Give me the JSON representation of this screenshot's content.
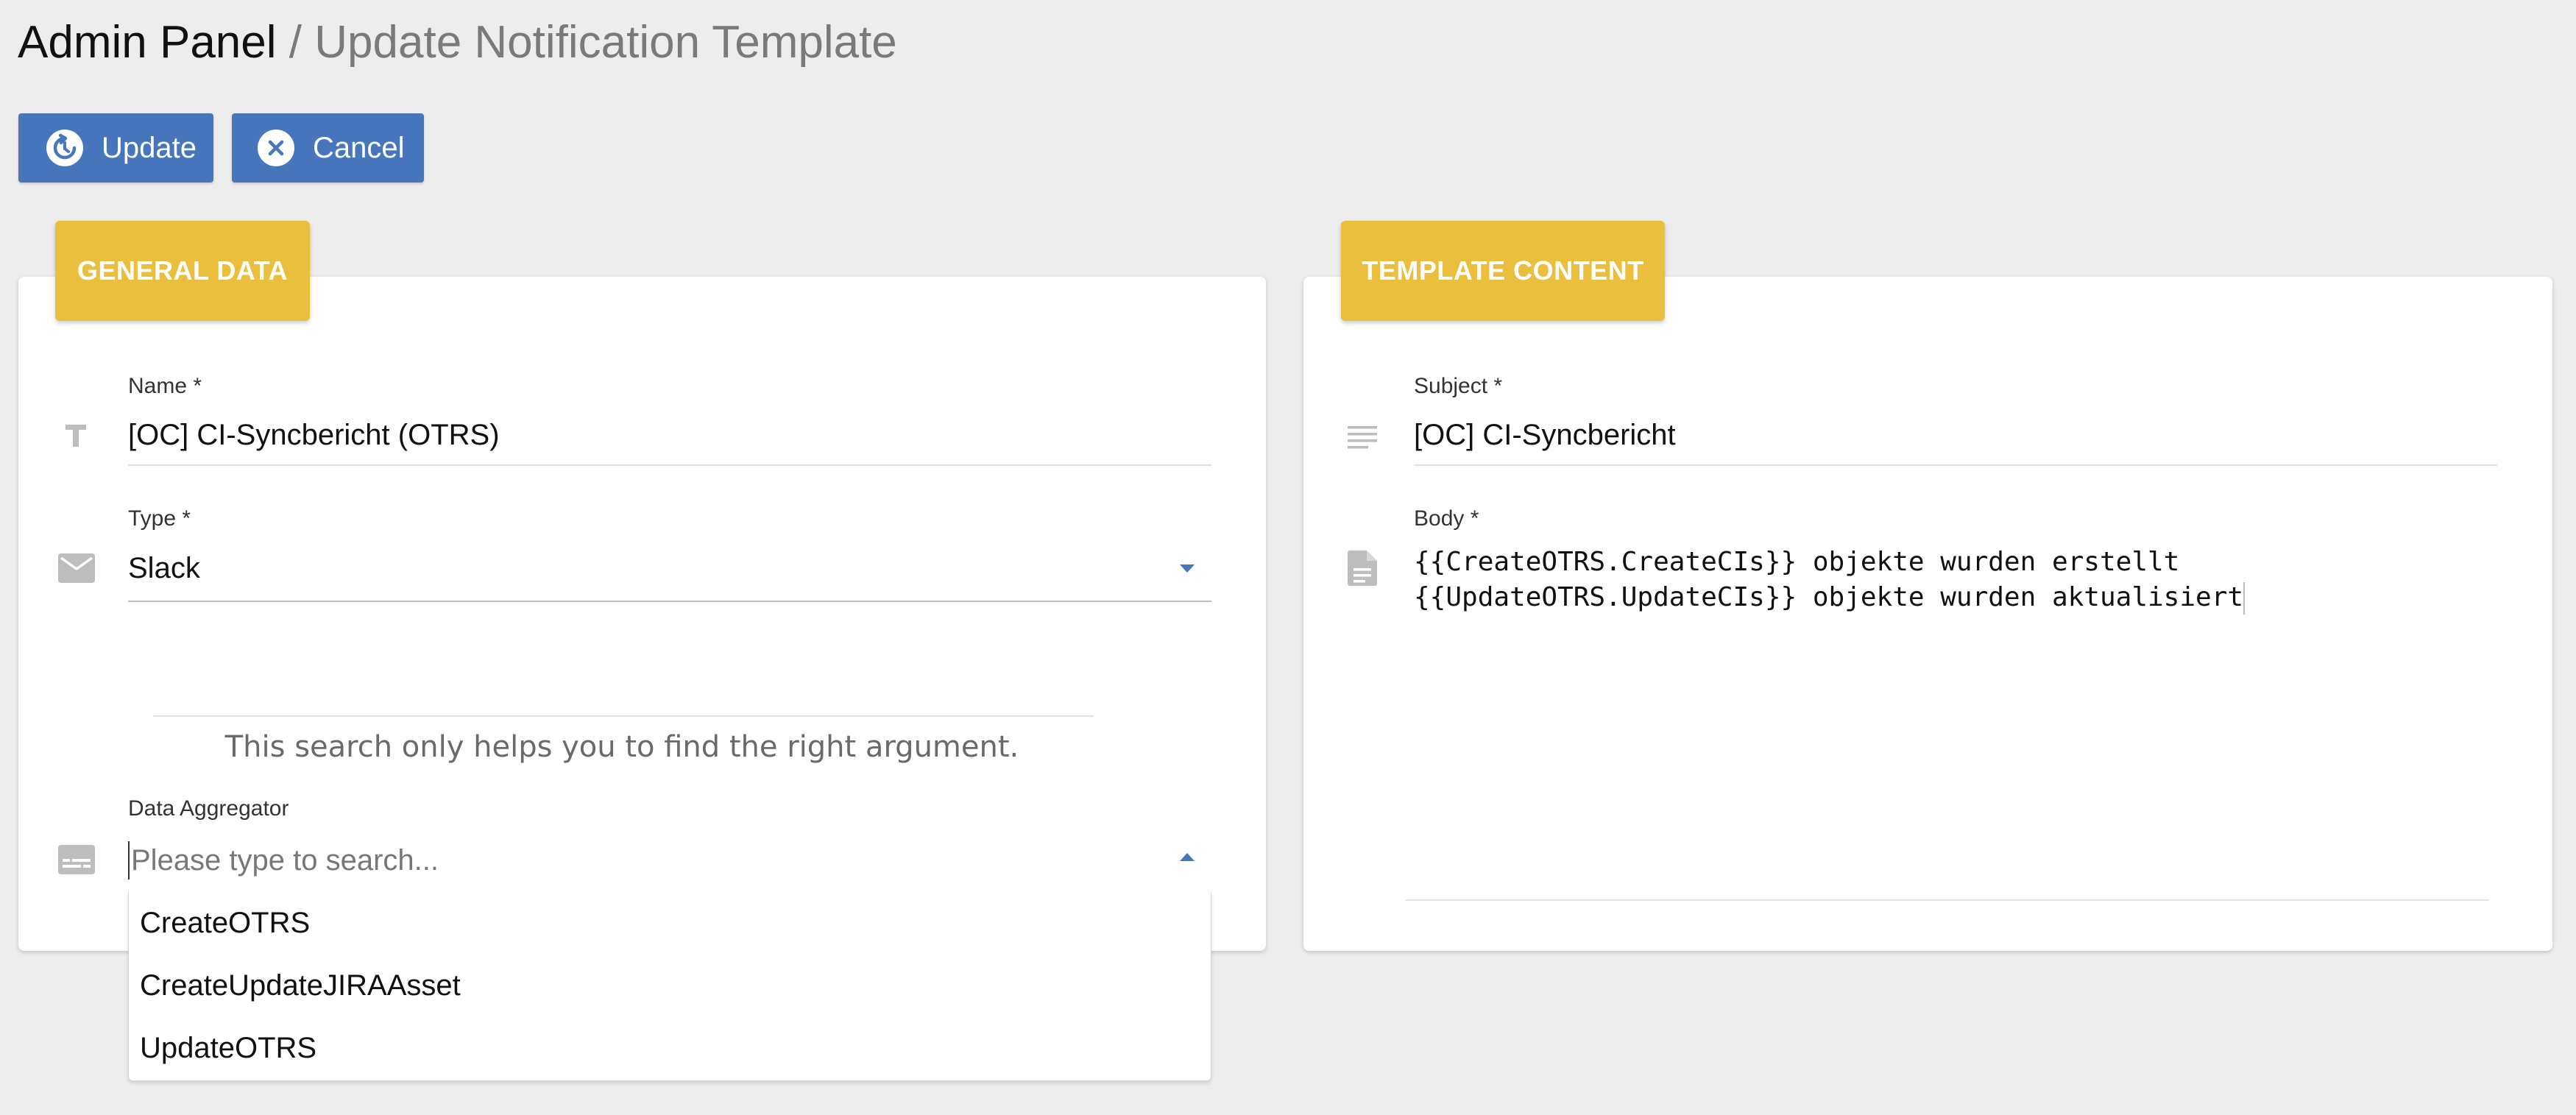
{
  "breadcrumb": {
    "root": "Admin Panel",
    "separator": "/",
    "current": "Update Notification Template"
  },
  "toolbar": {
    "update_label": "Update",
    "cancel_label": "Cancel"
  },
  "general_data": {
    "tab_label": "GENERAL DATA",
    "name": {
      "label": "Name *",
      "value": "[OC] CI-Syncbericht (OTRS)"
    },
    "type": {
      "label": "Type *",
      "value": "Slack"
    },
    "search_hint": "This search only helps you to find the right argument.",
    "data_aggregator": {
      "label": "Data Aggregator",
      "placeholder": "Please type to search...",
      "options": [
        "CreateOTRS",
        "CreateUpdateJIRAAsset",
        "UpdateOTRS"
      ]
    }
  },
  "template_content": {
    "tab_label": "TEMPLATE CONTENT",
    "subject": {
      "label": "Subject *",
      "value": "[OC] CI-Syncbericht"
    },
    "body": {
      "label": "Body *",
      "lines": [
        "{{CreateOTRS.CreateCIs}} objekte wurden erstellt",
        "{{UpdateOTRS.UpdateCIs}} objekte wurden aktualisiert"
      ]
    }
  },
  "colors": {
    "primary": "#4776bd",
    "accent": "#ebbf3e",
    "background": "#ededed"
  },
  "icons": {
    "update": "refresh-circle-icon",
    "cancel": "close-circle-icon",
    "name": "text-format-icon",
    "type": "envelope-icon",
    "aggregator": "subtitles-icon",
    "subject": "subject-lines-icon",
    "body": "document-icon"
  }
}
